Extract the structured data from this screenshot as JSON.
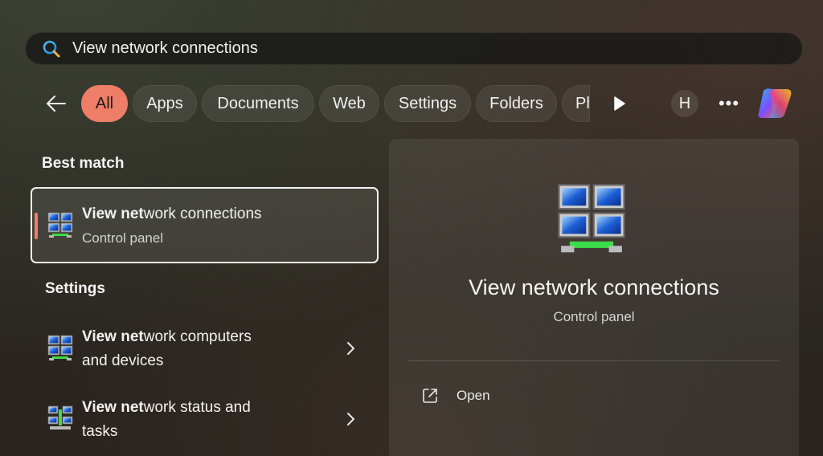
{
  "search": {
    "query": "View network connections",
    "icon": "search-icon"
  },
  "filters": {
    "items": [
      {
        "label": "All",
        "active": true
      },
      {
        "label": "Apps"
      },
      {
        "label": "Documents"
      },
      {
        "label": "Web"
      },
      {
        "label": "Settings"
      },
      {
        "label": "Folders"
      },
      {
        "label": "Ph"
      }
    ],
    "avatar_initial": "H",
    "more_label": "•••"
  },
  "best_match": {
    "heading": "Best match",
    "item": {
      "title_bold": "View net",
      "title_rest": "work connections",
      "subtitle": "Control panel",
      "icon": "network-connections-icon"
    }
  },
  "settings": {
    "heading": "Settings",
    "items": [
      {
        "title_bold": "View net",
        "title_rest": "work computers",
        "title_line2": "and devices",
        "icon": "network-computers-icon"
      },
      {
        "title_bold": "View net",
        "title_rest": "work status and",
        "title_line2": "tasks",
        "icon": "network-status-icon"
      }
    ]
  },
  "preview": {
    "title": "View network connections",
    "subtitle": "Control panel",
    "actions": [
      {
        "label": "Open",
        "icon": "open-external-icon"
      }
    ]
  },
  "colors": {
    "accent": "#ee7e68",
    "panel": "rgba(255,255,255,0.07)"
  }
}
